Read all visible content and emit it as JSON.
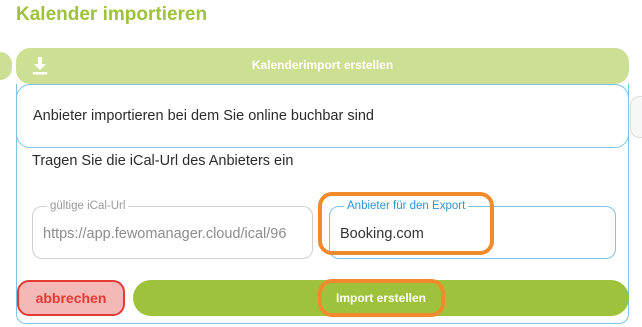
{
  "page": {
    "title": "Kalender importieren"
  },
  "top_bar": {
    "label": "Kalenderimport erstellen",
    "icon": "download-icon"
  },
  "provider_box": {
    "text": "Anbieter importieren bei dem Sie online buchbar sind"
  },
  "instruction": "Tragen Sie die iCal-Url des Anbieters ein",
  "fields": {
    "ical": {
      "label": "gültige iCal-Url",
      "value": "https://app.fewomanager.cloud/ical/96"
    },
    "export": {
      "label": "Anbieter für den Export",
      "value": "Booking.com"
    }
  },
  "buttons": {
    "cancel": "abbrechen",
    "import": "Import erstellen"
  },
  "colors": {
    "accent_green": "#9ec23c",
    "light_green": "#cddf93",
    "blue_border": "#7fc3e6",
    "cancel_red": "#e23b34",
    "highlight_orange": "#f08a2c"
  }
}
